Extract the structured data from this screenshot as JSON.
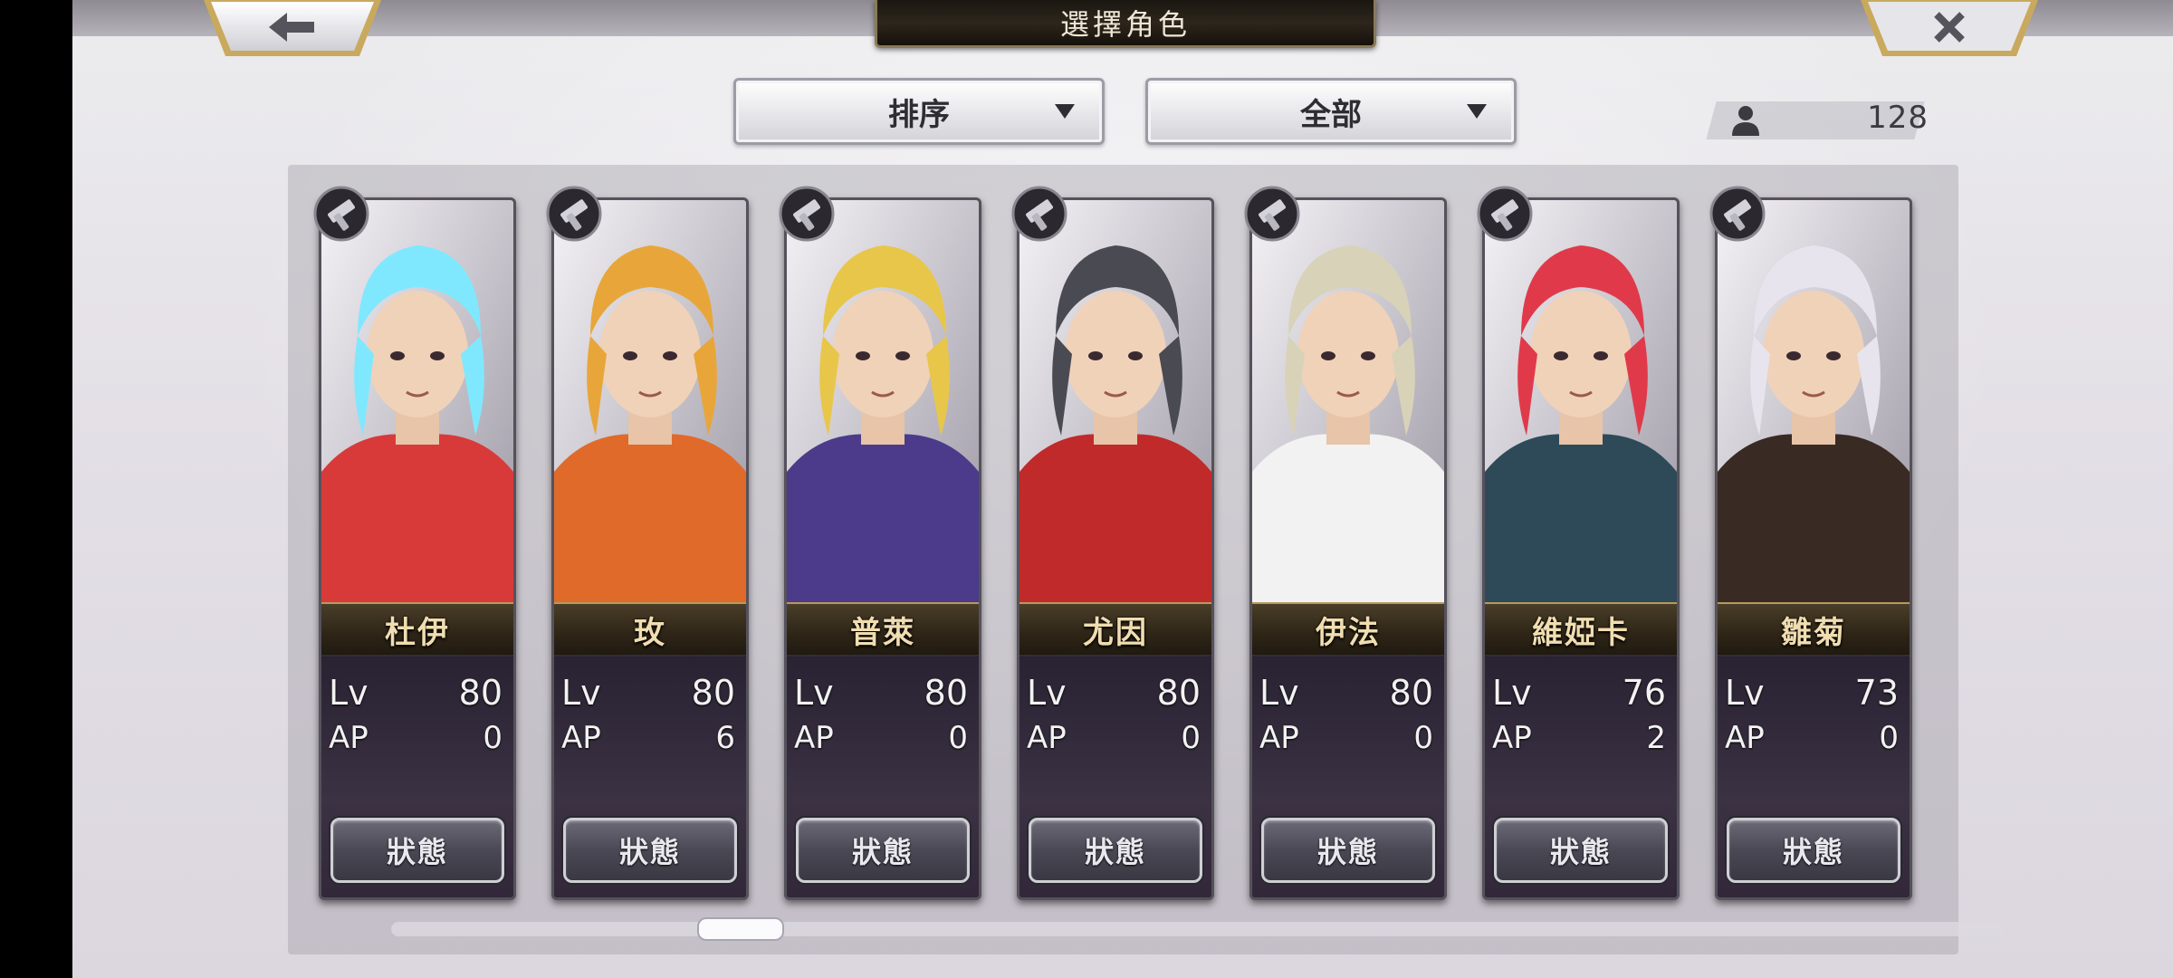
{
  "header": {
    "title": "選擇角色"
  },
  "nav": {
    "back_icon": "arrow-left-icon",
    "close_icon": "close-x-icon"
  },
  "filters": {
    "sort_label": "排序",
    "filter_label": "全部"
  },
  "roster": {
    "count": "128",
    "icon": "person-icon"
  },
  "labels": {
    "lv": "Lv",
    "ap": "AP",
    "status_button": "狀態"
  },
  "characters": [
    {
      "name": "杜伊",
      "lv": "80",
      "ap": "0",
      "accent": "#d83a3a",
      "hair": "#7fe8ff"
    },
    {
      "name": "玫",
      "lv": "80",
      "ap": "6",
      "accent": "#e06a2a",
      "hair": "#e8a63a"
    },
    {
      "name": "普萊",
      "lv": "80",
      "ap": "0",
      "accent": "#4b3b8a",
      "hair": "#e8c64a"
    },
    {
      "name": "尤因",
      "lv": "80",
      "ap": "0",
      "accent": "#c02a2a",
      "hair": "#4a4a52"
    },
    {
      "name": "伊法",
      "lv": "80",
      "ap": "0",
      "accent": "#f2f2f2",
      "hair": "#d8d2b8"
    },
    {
      "name": "維婭卡",
      "lv": "76",
      "ap": "2",
      "accent": "#2e4a58",
      "hair": "#e03a4a"
    },
    {
      "name": "雛菊",
      "lv": "73",
      "ap": "0",
      "accent": "#3a2a24",
      "hair": "#e8e4ee"
    }
  ],
  "scroll": {
    "position": 0.2
  }
}
